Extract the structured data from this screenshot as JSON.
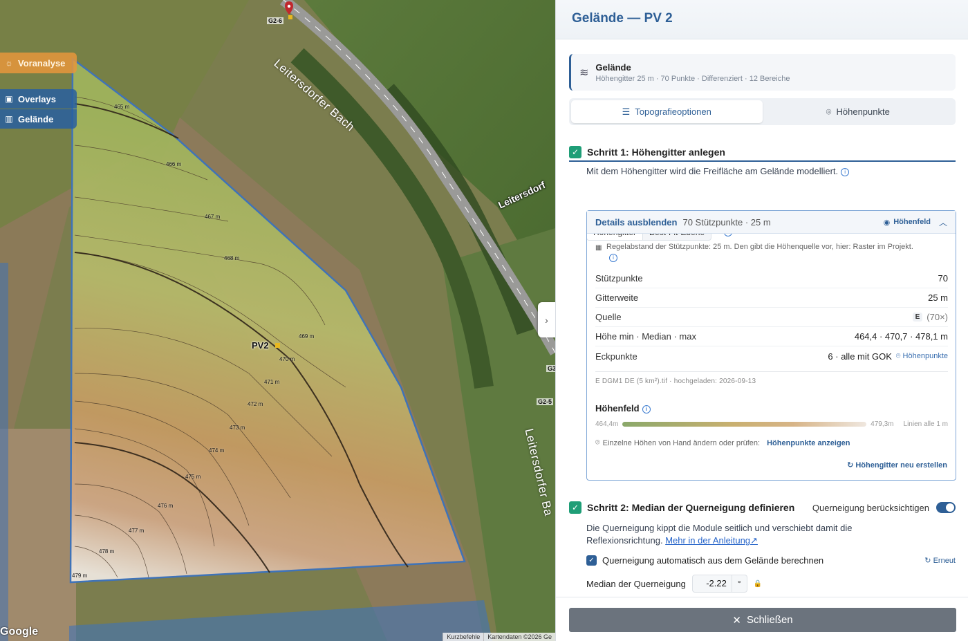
{
  "panel": {
    "title": "Gelände — PV 2",
    "layer": {
      "title": "Gelände",
      "subtitle": "Höhengitter 25 m · 70 Punkte · Differenziert · 12 Bereiche",
      "icon": "layers-icon"
    },
    "tabs": [
      {
        "label": "Topografieoptionen",
        "icon": "list-icon",
        "active": true
      },
      {
        "label": "Höhenpunkte",
        "icon": "location-pin-icon",
        "active": false
      }
    ],
    "step1": {
      "title": "Schritt 1: Höhengitter anlegen",
      "description": "Mit dem Höhengitter wird die Freifläche am Gelände modelliert.",
      "segments": [
        "Höhengitter",
        "Best-Fit-Ebene"
      ],
      "details": {
        "title": "Details ausblenden",
        "meta": "70 Stützpunkte · 25 m",
        "toggle_label": "Höhenfeld",
        "note": "Regelabstand der Stützpunkte: 25 m. Den gibt die Höhenquelle vor, hier: Raster im Projekt.",
        "rows": [
          {
            "key": "Stützpunkte",
            "value": "70"
          },
          {
            "key": "Gitterweite",
            "value": "25 m"
          },
          {
            "key": "Quelle",
            "badge": "E",
            "value": "(70×)"
          },
          {
            "key": "Höhe min · Median · max",
            "value": "464,4 · 470,7 · 478,1 m"
          },
          {
            "key": "Eckpunkte",
            "value": "6 · alle mit GOK",
            "link": "Höhenpunkte"
          }
        ],
        "file_note": "E DGM1 DE (5 km²).tif · hochgeladen: 2026-09-13",
        "heightfield": {
          "title": "Höhenfeld",
          "min_label": "464,4m",
          "max_label": "479,3m",
          "lines_label": "Linien alle 1 m",
          "hint": "Einzelne Höhen von Hand ändern oder prüfen:",
          "hint_link": "Höhenpunkte anzeigen",
          "regen": "Höhengitter neu erstellen"
        }
      }
    },
    "step2": {
      "title": "Schritt 2: Median der Querneigung definieren",
      "toggle_label": "Querneigung berücksichtigen",
      "toggle_on": true,
      "description": "Die Querneigung kippt die Module seitlich und verschiebt damit die Reflexionsrichtung.",
      "link": "Mehr in der Anleitung",
      "auto_label": "Querneigung automatisch aus dem Gelände berechnen",
      "again_label": "Erneut",
      "median_label": "Median der Querneigung",
      "median_value": "-2.22",
      "median_unit": "°"
    },
    "close_label": "Schließen"
  },
  "map": {
    "buttons": {
      "voranalyse": "Voranalyse",
      "overlays": "Overlays",
      "gelaende": "Gelände"
    },
    "labels": {
      "creek_top": "Leitersdorfer Bach",
      "creek_right": "Leitersdorfer Ba",
      "town": "Leitersdorf",
      "pv": "PV2",
      "pin_top": "G2-6",
      "pin_right1": "G3",
      "pin_right2": "G2-5"
    },
    "contours": [
      "465 m",
      "466 m",
      "467 m",
      "468 m",
      "469 m",
      "470 m",
      "471 m",
      "472 m",
      "473 m",
      "474 m",
      "475 m",
      "476 m",
      "477 m",
      "478 m",
      "479 m"
    ],
    "logo": "Google",
    "footer": [
      "Kurzbefehle",
      "Kartendaten ©2026 Ge"
    ]
  }
}
